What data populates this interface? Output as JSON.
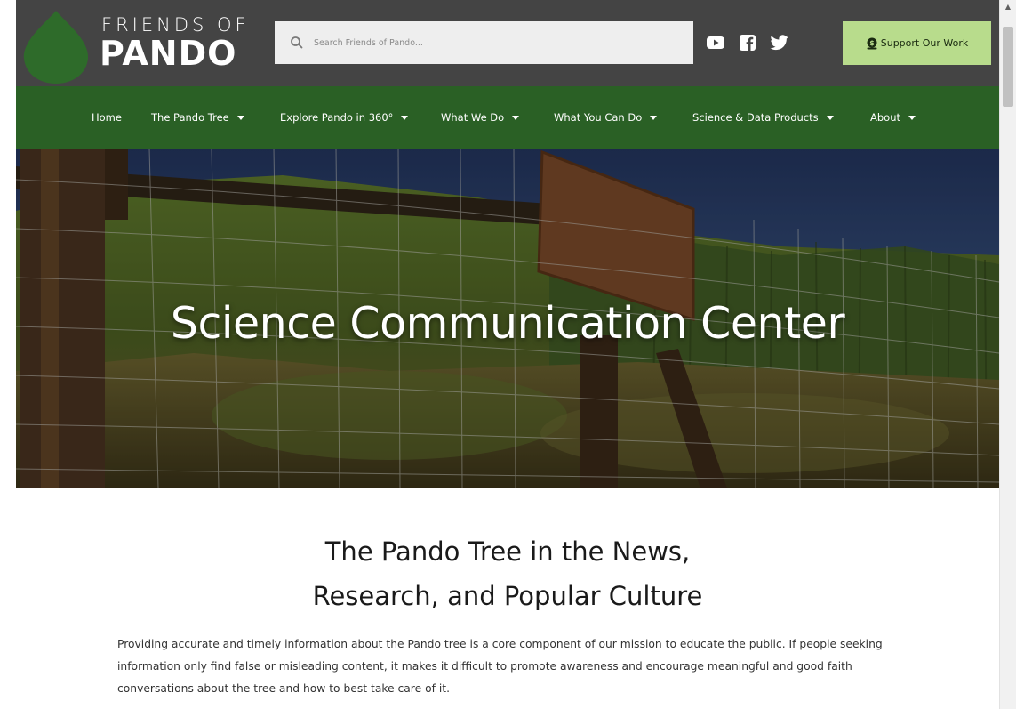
{
  "header": {
    "logo_top": "FRIENDS OF",
    "logo_main": "PANDO",
    "search_placeholder": "Search Friends of Pando...",
    "social": [
      "youtube-icon",
      "facebook-icon",
      "twitter-icon"
    ],
    "support_label": "Support Our Work"
  },
  "nav": {
    "items": [
      {
        "label": "Home",
        "dropdown": false
      },
      {
        "label": "The Pando Tree",
        "dropdown": true
      },
      {
        "label": "Explore Pando in 360°",
        "dropdown": true
      },
      {
        "label": "What We Do",
        "dropdown": true
      },
      {
        "label": "What You Can Do",
        "dropdown": true
      },
      {
        "label": "Science & Data Products",
        "dropdown": true
      },
      {
        "label": "About",
        "dropdown": true
      }
    ]
  },
  "hero": {
    "title": "Science Communication Center"
  },
  "content": {
    "title_line1": "The Pando Tree in the News,",
    "title_line2": "Research, and Popular Culture",
    "intro": "Providing accurate and timely information about the Pando tree is a core component of our mission to educate the public. If people seeking information only find false or misleading content, it makes it difficult to promote awareness and encourage meaningful and good faith conversations about the tree and how to best take care of it."
  },
  "colors": {
    "header_bg": "#444444",
    "nav_bg": "#2a6025",
    "support_bg": "#b8dc8c",
    "logo_green": "#2e6b2a"
  }
}
